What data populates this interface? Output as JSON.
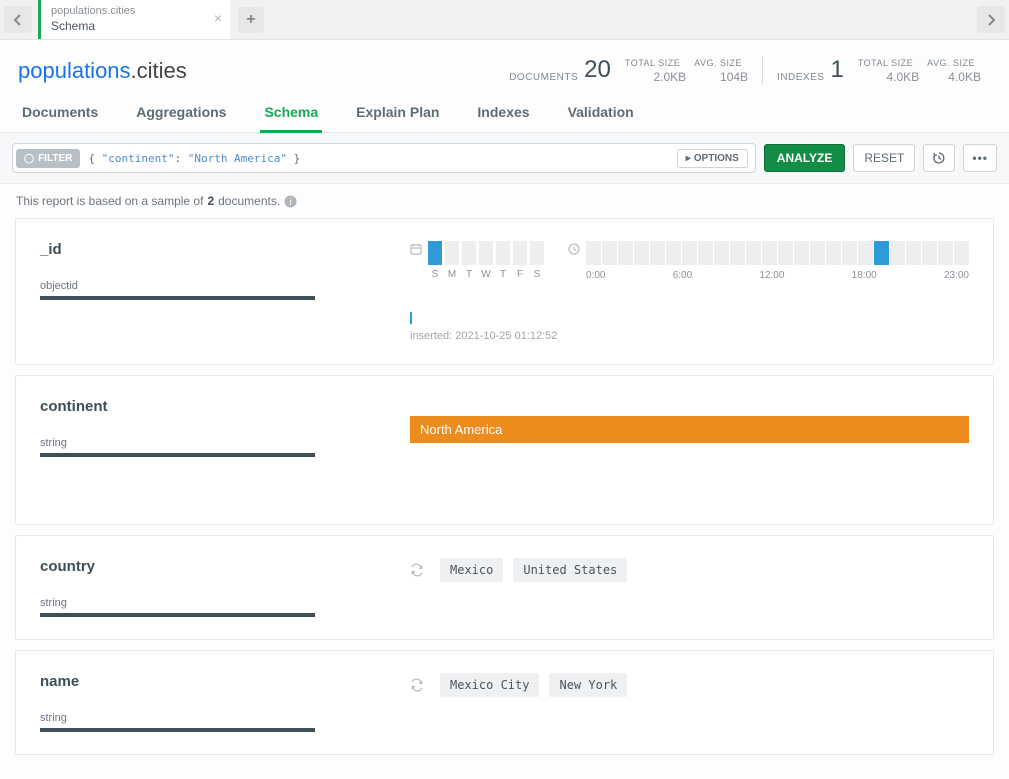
{
  "tabStrip": {
    "active": {
      "title": "populations.cities",
      "subtitle": "Schema"
    }
  },
  "breadcrumb": {
    "db": "populations",
    "coll": "cities"
  },
  "stats": {
    "documents": {
      "label": "DOCUMENTS",
      "value": "20",
      "totalSizeLabel": "TOTAL SIZE",
      "totalSize": "2.0KB",
      "avgSizeLabel": "AVG. SIZE",
      "avgSize": "104B"
    },
    "indexes": {
      "label": "INDEXES",
      "value": "1",
      "totalSizeLabel": "TOTAL SIZE",
      "totalSize": "4.0KB",
      "avgSizeLabel": "AVG. SIZE",
      "avgSize": "4.0KB"
    }
  },
  "navTabs": [
    "Documents",
    "Aggregations",
    "Schema",
    "Explain Plan",
    "Indexes",
    "Validation"
  ],
  "activeNavTab": 2,
  "filter": {
    "chip": "FILTER",
    "queryKey": "\"continent\"",
    "queryVal": "\"North America\"",
    "options": "OPTIONS",
    "analyze": "ANALYZE",
    "reset": "RESET"
  },
  "sample": {
    "prefix": "This report is based on a sample of ",
    "count": "2",
    "suffix": " documents."
  },
  "fields": {
    "id": {
      "name": "_id",
      "type": "objectid",
      "days": [
        "S",
        "M",
        "T",
        "W",
        "T",
        "F",
        "S"
      ],
      "activeDay": 0,
      "hours": [
        "0:00",
        "6:00",
        "12:00",
        "18:00",
        "23:00"
      ],
      "activeHour": 18,
      "inserted": "inserted: 2021-10-25 01:12:52"
    },
    "continent": {
      "name": "continent",
      "type": "string",
      "value": "North America"
    },
    "country": {
      "name": "country",
      "type": "string",
      "values": [
        "Mexico",
        "United States"
      ]
    },
    "cname": {
      "name": "name",
      "type": "string",
      "values": [
        "Mexico City",
        "New York"
      ]
    }
  }
}
